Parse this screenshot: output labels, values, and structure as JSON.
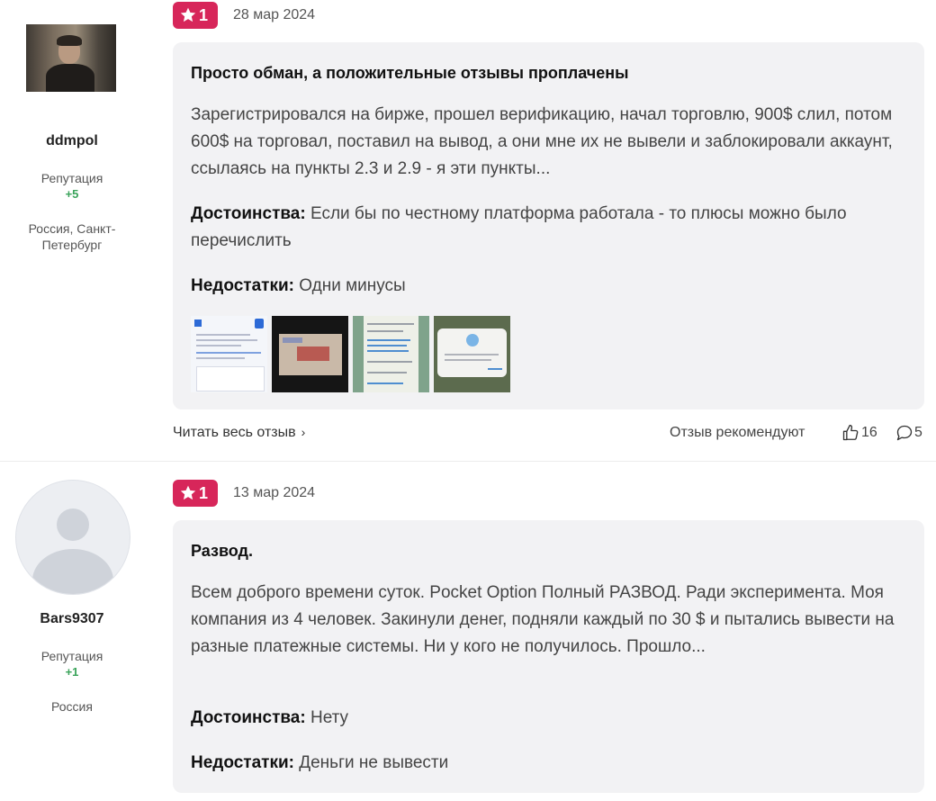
{
  "reviews": [
    {
      "user": {
        "name": "ddmpol",
        "reputation_label": "Репутация",
        "reputation": "+5",
        "location": "Россия, Санкт-Петербург"
      },
      "rating": "1",
      "date": "28 мар 2024",
      "title": "Просто обман, а положительные отзывы проплачены",
      "text": "Зарегистрировался на бирже, прошел верификацию, начал торговлю, 900$ слил, потом 600$ на торговал, поставил на вывод, а они мне их не вывели и заблокировали аккаунт, ссылаясь на пункты 2.3 и 2.9 - я эти пункты...",
      "pros_label": "Достоинства:",
      "pros": "Если бы по честному платформа работала - то плюсы можно было перечислить",
      "cons_label": "Недостатки:",
      "cons": "Одни минусы",
      "read_more": "Читать весь отзыв",
      "recommend_label": "Отзыв рекомендуют",
      "likes": "16",
      "comments": "5"
    },
    {
      "user": {
        "name": "Bars9307",
        "reputation_label": "Репутация",
        "reputation": "+1",
        "location": "Россия"
      },
      "rating": "1",
      "date": "13 мар 2024",
      "title": "Развод.",
      "text": "Всем доброго времени суток. Pocket Option Полный РАЗВОД. Ради эксперимента. Моя компания из 4 человек. Закинули денег, подняли каждый по 30 $ и пытались вывести на разные платежные системы. Ни у кого не получилось. Прошло...",
      "pros_label": "Достоинства:",
      "pros": "Нету",
      "cons_label": "Недостатки:",
      "cons": "Деньги не вывести"
    }
  ],
  "icons": {
    "rating": "star-icon",
    "like": "thumbs-up-icon",
    "comment": "comment-icon",
    "chevron": "chevron-right-icon"
  },
  "colors": {
    "rating_badge": "#d7265a",
    "reputation": "#3aa35a",
    "card_bg": "#f2f2f4"
  }
}
